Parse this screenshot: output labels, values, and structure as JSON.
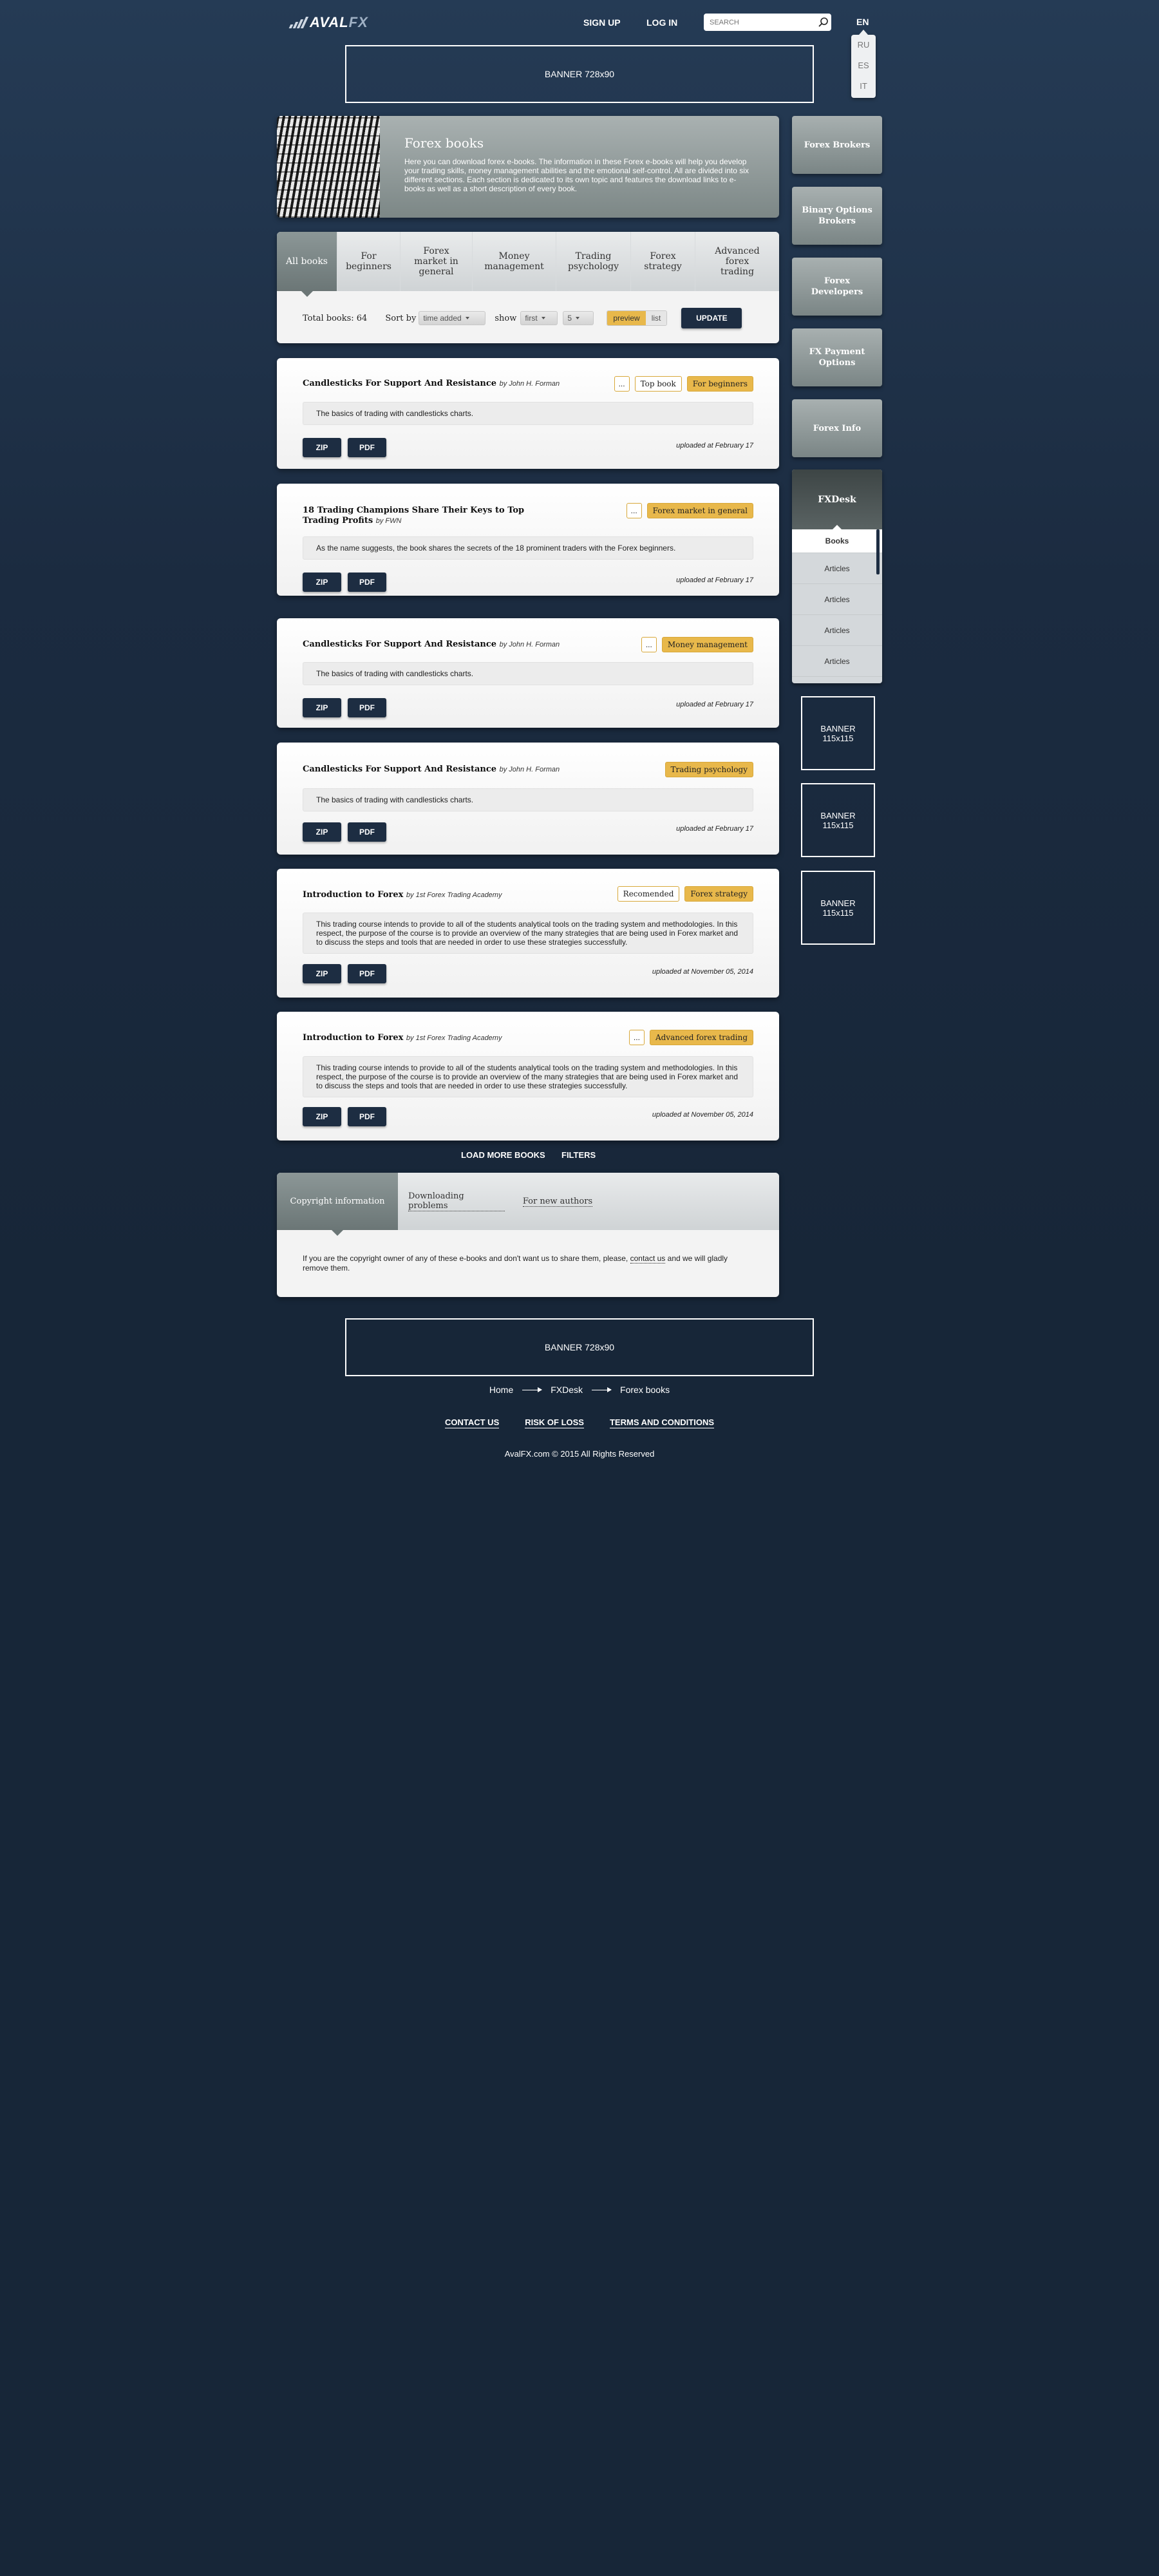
{
  "header": {
    "logo_text": "AVAL",
    "logo_text_fx": "FX",
    "signup": "SIGN UP",
    "login": "LOG IN",
    "search_placeholder": "SEARCH",
    "lang_current": "EN",
    "lang_options": [
      "RU",
      "ES",
      "IT"
    ]
  },
  "banners": {
    "top": "BANNER 728x90",
    "bottom": "BANNER 728x90",
    "side": [
      "BANNER\n115x115",
      "BANNER\n115x115",
      "BANNER\n115x115"
    ]
  },
  "hero": {
    "title": "Forex books",
    "text": "Here you can download forex e-books. The information in these Forex e-books will help you develop your trading skills, money management abilities and the emotional self-control. All are divided into six different sections. Each section is dedicated to its own topic and features the download links to e-books as well as a short description of every book."
  },
  "categories": {
    "tabs": [
      "All books",
      "For beginners",
      "Forex market in general",
      "Money management",
      "Trading psychology",
      "Forex strategy",
      "Advanced forex trading"
    ],
    "total_label": "Total books: 64",
    "sort_label": "Sort by",
    "sort_value": "time added",
    "show_label": "show",
    "show_value": "first",
    "count_value": "5",
    "view_preview": "preview",
    "view_list": "list",
    "update": "UPDATE"
  },
  "books": [
    {
      "title": "Candlesticks For Support And Resistance",
      "author": "by John H. Forman",
      "tags": [
        "...",
        "Top book",
        "For beginners"
      ],
      "desc": "The basics of trading with candlesticks charts.",
      "zip": "ZIP",
      "pdf": "PDF",
      "uploaded": "uploaded at February 17"
    },
    {
      "title": "18 Trading Champions Share Their Keys to Top Trading Profits",
      "title_l1": "18 Trading Champions Share Their Keys to Top",
      "title_l2": "Trading Profits",
      "author": "by FWN",
      "tags": [
        "...",
        "Forex market in general"
      ],
      "desc": "As the name suggests, the book shares the secrets of the 18 prominent traders with the Forex beginners.",
      "zip": "ZIP",
      "pdf": "PDF",
      "uploaded": "uploaded at February 17"
    },
    {
      "title": "Candlesticks For Support And Resistance",
      "author": "by John H. Forman",
      "tags": [
        "...",
        "Money management"
      ],
      "desc": "The basics of trading with candlesticks charts.",
      "zip": "ZIP",
      "pdf": "PDF",
      "uploaded": "uploaded at February 17"
    },
    {
      "title": "Candlesticks For Support And Resistance",
      "author": "by John H. Forman",
      "tags": [
        "Trading psychology"
      ],
      "desc": "The basics of trading with candlesticks charts.",
      "zip": "ZIP",
      "pdf": "PDF",
      "uploaded": "uploaded at February 17"
    },
    {
      "title": "Introduction to Forex",
      "author": "by 1st Forex Trading Academy",
      "tags": [
        "Recomended",
        "Forex strategy"
      ],
      "desc": "This trading course intends to provide to all of the students analytical tools on the trading system and methodologies. In this respect, the purpose of the course is to provide an overview of the many strategies that are being used in Forex market and to discuss the steps and tools that are needed in order to use these strategies successfully.",
      "zip": "ZIP",
      "pdf": "PDF",
      "uploaded": "uploaded at November 05, 2014"
    },
    {
      "title": "Introduction to Forex",
      "author": "by 1st Forex Trading Academy",
      "tags": [
        "...",
        "Advanced forex trading"
      ],
      "desc": "This trading course intends to provide to all of the students analytical tools on the trading system and methodologies. In this respect, the purpose of the course is to provide an overview of the many strategies that are being used in Forex market and to discuss the steps and tools that are needed in order to use these strategies successfully.",
      "zip": "ZIP",
      "pdf": "PDF",
      "uploaded": "uploaded at November 05, 2014"
    }
  ],
  "load_more": "LOAD MORE BOOKS",
  "filters_link": "FILTERS",
  "info": {
    "tabs": [
      "Copyright information",
      "Downloading problems",
      "For new authors"
    ],
    "text_before": "If you are the copyright owner of any of these e-books and don't want us to share them, please,",
    "link": "contact us",
    "text_after": "and we will gladly remove them."
  },
  "breadcrumbs": [
    "Home",
    "FXDesk",
    "Forex books"
  ],
  "footer_links": [
    "CONTACT US",
    "RISK OF LOSS",
    "TERMS AND CONDITIONS"
  ],
  "copyright": "AvalFX.com © 2015 All Rights Reserved",
  "sidebar": {
    "buttons": [
      "Forex Brokers",
      "Binary Options Brokers",
      "Forex Developers",
      "FX Payment Options",
      "Forex Info"
    ],
    "fxdesk_title": "FXDesk",
    "fxdesk_items": [
      "Books",
      "Articles",
      "Articles",
      "Articles",
      "Articles"
    ]
  },
  "colors": {
    "accent": "#e8b84b",
    "dark_button": "#1d2d42",
    "background": "#1b2b40"
  }
}
